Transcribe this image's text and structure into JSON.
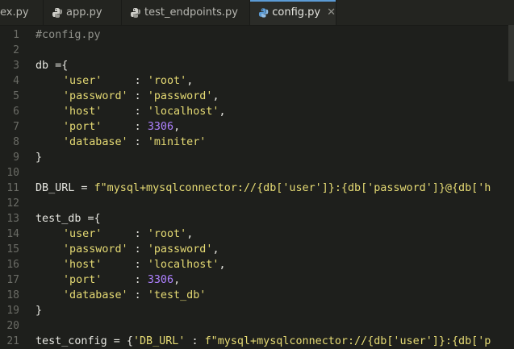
{
  "tabs": [
    {
      "label": "ex.py",
      "icon": "python-icon",
      "active": false
    },
    {
      "label": "app.py",
      "icon": "python-icon",
      "active": false
    },
    {
      "label": "test_endpoints.py",
      "icon": "python-icon",
      "active": false
    },
    {
      "label": "config.py",
      "icon": "python-icon",
      "active": true,
      "close": "✕"
    }
  ],
  "line_numbers": [
    "1",
    "2",
    "3",
    "4",
    "5",
    "6",
    "7",
    "8",
    "9",
    "10",
    "11",
    "12",
    "13",
    "14",
    "15",
    "16",
    "17",
    "18",
    "19",
    "20",
    "21"
  ],
  "code": {
    "l1_comment": "#config.py",
    "l3": "db ={",
    "l4_key": "'user'",
    "l4_pad": "     : ",
    "l4_val": "'root'",
    "l5_key": "'password'",
    "l5_pad": " : ",
    "l5_val": "'password'",
    "l6_key": "'host'",
    "l6_pad": "     : ",
    "l6_val": "'localhost'",
    "l7_key": "'port'",
    "l7_pad": "     : ",
    "l7_val": "3306",
    "l8_key": "'database'",
    "l8_pad": " : ",
    "l8_val": "'miniter'",
    "l9": "}",
    "l11_lhs": "DB_URL = ",
    "l11_rhs": "f\"mysql+mysqlconnector://{db['user']}:{db['password']}@{db['h",
    "l13": "test_db ={",
    "l14_key": "'user'",
    "l14_pad": "     : ",
    "l14_val": "'root'",
    "l15_key": "'password'",
    "l15_pad": " : ",
    "l15_val": "'password'",
    "l16_key": "'host'",
    "l16_pad": "     : ",
    "l16_val": "'localhost'",
    "l17_key": "'port'",
    "l17_pad": "     : ",
    "l17_val": "3306",
    "l18_key": "'database'",
    "l18_pad": " : ",
    "l18_val": "'test_db'",
    "l19": "}",
    "l21_lhs": "test_config = {",
    "l21_key": "'DB_URL'",
    "l21_mid": " : ",
    "l21_rhs": "f\"mysql+mysqlconnector://{db['user']}:{db['p"
  },
  "colors": {
    "background": "#1e1f1c",
    "string": "#e6db74",
    "number": "#ae81ff",
    "comment": "#8f908a",
    "active_tab_accent": "#5b9bd5"
  }
}
